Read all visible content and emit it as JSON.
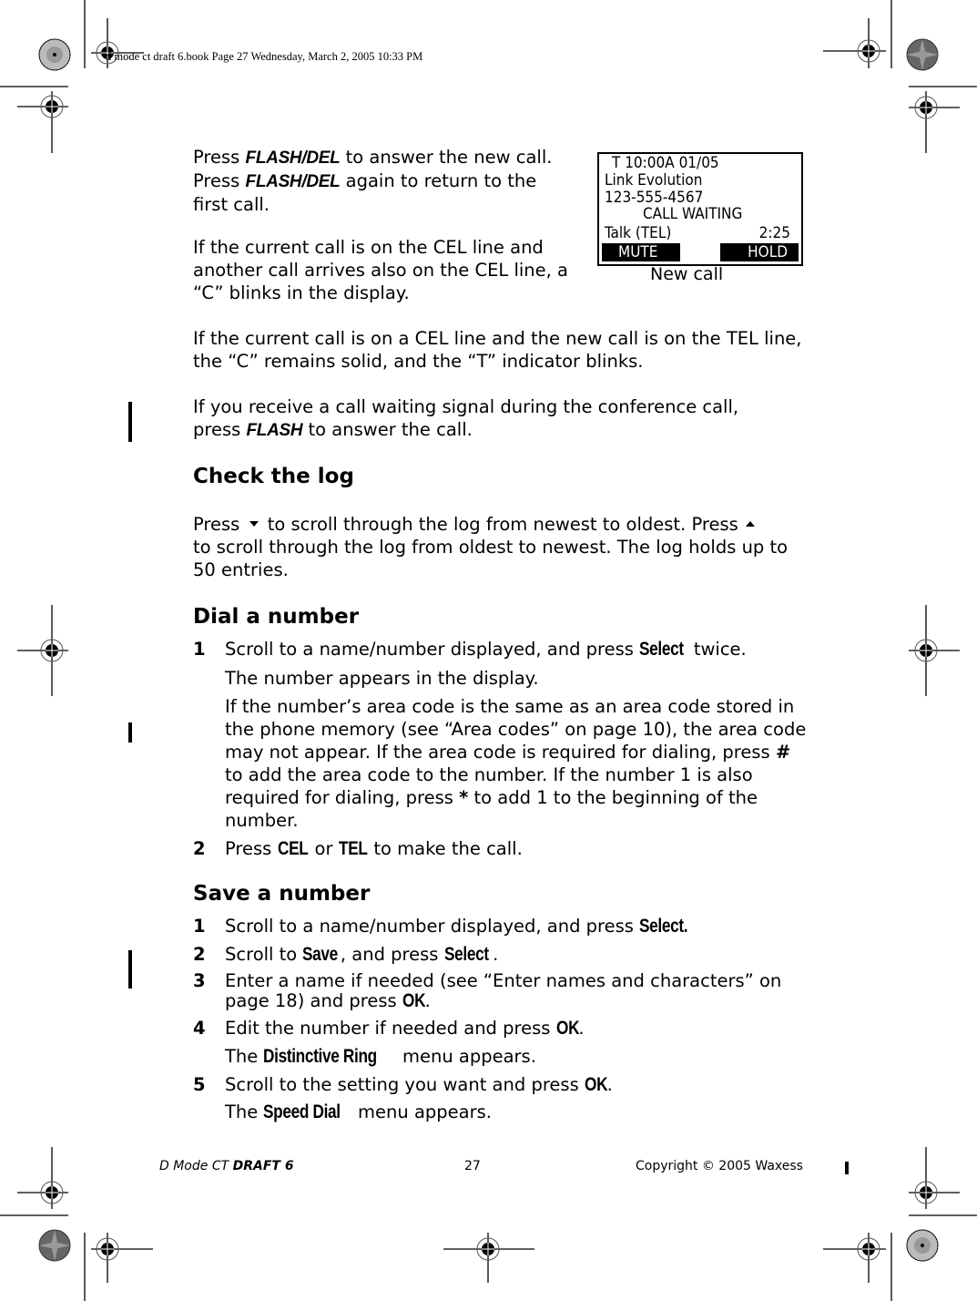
{
  "slug": "d mode ct draft 6.book  Page 27  Wednesday, March 2, 2005  10:33 PM",
  "intro": {
    "p1": {
      "a": "Press ",
      "k1": "FLASH/DEL",
      "b": " to answer the new call.",
      "c": "Press ",
      "k2": "FLASH/DEL",
      "d": " again to return to the",
      "e": "first call."
    },
    "p2": "If the current call is on the CEL line and another call arrives also on the CEL line, a “C” blinks in the display.",
    "p3": "If the current call is on a CEL line and the new call is on the TEL line, the “C” remains solid, and the “T” indicator blinks.",
    "p4": {
      "a": "If you receive a call waiting signal during the conference call,",
      "b": "press ",
      "k": "FLASH",
      "c": " to answer the call."
    }
  },
  "lcd": {
    "line1": "T 10:00A 01/05",
    "line2": "Link Evolution",
    "line3": "123-555-4567",
    "line4": "CALL WAITING",
    "line5_left": "Talk (TEL)",
    "line5_right": "2:25",
    "soft_left": "MUTE",
    "soft_right": "HOLD",
    "caption": "New call"
  },
  "check_log": {
    "heading": "Check the log",
    "a": "Press ",
    "down_icon": "down-arrow-icon",
    "b": " to scroll through the log from newest to oldest. Press ",
    "up_icon": "up-arrow-icon",
    "c": "to scroll through the log from oldest to newest. The log holds up to 50 entries."
  },
  "dial": {
    "heading": "Dial a number",
    "step1": {
      "num": "1",
      "a": "Scroll to a name/number displayed, and press ",
      "k": "Select",
      "b": " twice."
    },
    "step1_sub1": "The number appears in the display.",
    "step1_sub2": {
      "a": "If the number’s area code is the same as an area code stored in the phone memory (see “Area codes” on page 10), the area code may not appear. If the area code is required for dialing, press ",
      "hash": "#",
      "b": " to add the area code to the number. If the number 1 is also required for dialing, press ",
      "star": "*",
      "c": " to add 1 to the beginning of the number."
    },
    "step2": {
      "num": "2",
      "a": "Press ",
      "k1": "CEL",
      "b": " or ",
      "k2": "TEL",
      "c": " to make the call."
    }
  },
  "save": {
    "heading": "Save a number",
    "step1": {
      "num": "1",
      "a": "Scroll to a name/number displayed, and press ",
      "k": "Select."
    },
    "step2": {
      "num": "2",
      "a": "Scroll to ",
      "k1": "Save",
      "b": ", and press ",
      "k2": "Select",
      "c": "."
    },
    "step3": {
      "num": "3",
      "a": "Enter a name if needed (see “Enter names and characters” on page 18) and press ",
      "k": "OK",
      "b": "."
    },
    "step4": {
      "num": "4",
      "a": "Edit the number if needed and press ",
      "k": "OK",
      "b": "."
    },
    "step4_sub": {
      "a": "The ",
      "k": "Distinctive Ring",
      "b": " menu appears."
    },
    "step5": {
      "num": "5",
      "a": "Scroll to the setting you want and press ",
      "k": "OK",
      "b": "."
    },
    "step5_sub": {
      "a": "The ",
      "k": "Speed Dial",
      "b": " menu appears."
    }
  },
  "footer": {
    "title": "D Mode CT ",
    "draft": "DRAFT 6",
    "page": "27",
    "copyright": "Copyright © 2005 Waxess"
  }
}
